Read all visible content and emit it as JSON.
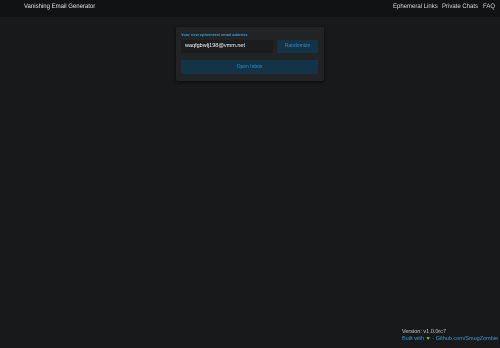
{
  "navbar": {
    "brand": "Vanishing Email Generator",
    "links": [
      {
        "label": "Ephemeral Links"
      },
      {
        "label": "Private Chats"
      },
      {
        "label": "FAQ"
      }
    ]
  },
  "generator": {
    "label": "Your new ephemeral email address",
    "email_value": "waqfgbwlj198@vmm.net",
    "randomize_label": "Randomize",
    "open_inbox_label": "Open Inbox"
  },
  "footer": {
    "version": "Version: v1.0.0rc7",
    "built_with": "Built with",
    "link": "- Github.com/SmugZombie"
  },
  "colors": {
    "accent": "#3a9bd8",
    "button_bg": "#123348",
    "heart": "#7fd12a"
  }
}
